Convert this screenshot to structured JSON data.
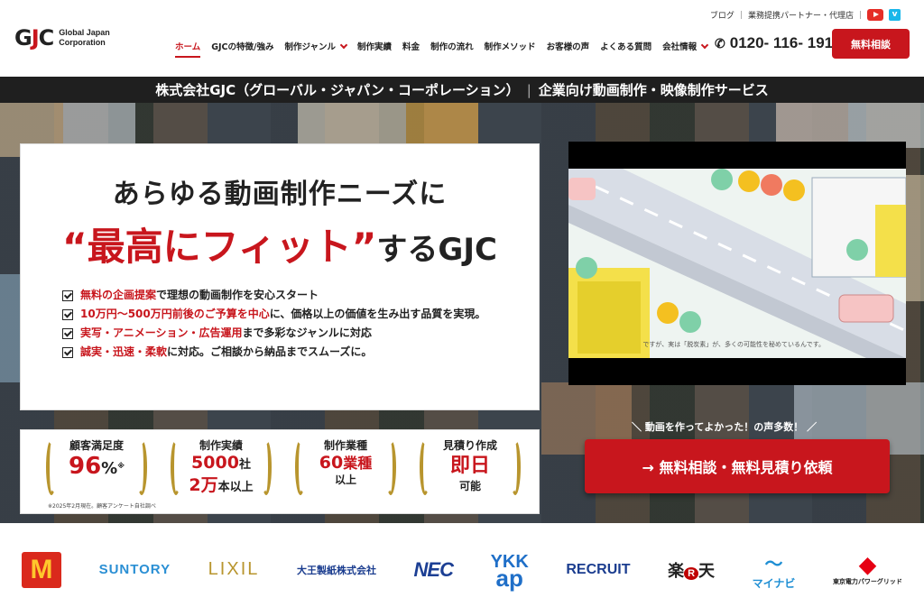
{
  "header": {
    "logo_mark_left": "G",
    "logo_mark_red": "J",
    "logo_mark_right": "C",
    "logo_text_line1": "Global Japan",
    "logo_text_line2": "Corporation",
    "toplinks": {
      "blog": "ブログ",
      "partner": "業務提携パートナー・代理店"
    },
    "nav": [
      {
        "label": "ホーム",
        "active": true
      },
      {
        "label": "GJCの特徴/強み"
      },
      {
        "label": "制作ジャンル"
      },
      {
        "label": "制作実績"
      },
      {
        "label": "料金"
      },
      {
        "label": "制作の流れ"
      },
      {
        "label": "制作メソッド"
      },
      {
        "label": "お客様の声"
      },
      {
        "label": "よくある質問"
      },
      {
        "label": "会社情報"
      }
    ],
    "phone": "0120- 116- 191",
    "cta": "無料相談"
  },
  "band": {
    "company": "株式会社GJC（グローバル・ジャパン・コーポレーション）",
    "service": "企業向け動画制作・映像制作サービス"
  },
  "hero": {
    "headline_line1": "あらゆる動画制作ニーズに",
    "headline_accent": "“最高にフィット”",
    "headline_rest": "するGJC",
    "checks": [
      {
        "red": "無料の企画提案",
        "text": "で理想の動画制作を安心スタート"
      },
      {
        "red": "10万円〜500万円前後のご予算を中心",
        "text": "に、価格以上の価値を生み出す品質を実現。"
      },
      {
        "red": "実写・アニメーション・広告運用",
        "text": "まで多彩なジャンルに対応"
      },
      {
        "red": "誠実・迅速・柔軟",
        "text": "に対応。ご相談から納品までスムーズに。"
      }
    ],
    "stats": [
      {
        "label": "顧客満足度",
        "big": "96",
        "unit": "%",
        "mark": "※"
      },
      {
        "label": "制作実績",
        "line1": "5000",
        "line1_unit": "社",
        "line2": "2万",
        "line2_unit": "本以上"
      },
      {
        "label": "制作業種",
        "line1": "60",
        "line1_unit": "業種",
        "line2_unit": "以上"
      },
      {
        "label": "見積り作成",
        "big": "即日",
        "sub": "可能"
      }
    ],
    "stat_note": "※2025年2月現在。顧客アンケート自社調べ",
    "video_caption": "ですが、実は「脱炭素」が、多くの可能性を秘めているんです。",
    "voice": "＼ 動画を作ってよかった！の声多数！ ／",
    "cta_main": "→ 無料相談・無料見積り依頼"
  },
  "logos": {
    "mcd": "M",
    "suntory": "SUNTORY",
    "lixil": "LIXIL",
    "daio": "大王製紙株式会社",
    "nec": "NEC",
    "ykk_top": "YKK",
    "ykk_bottom": "ap",
    "recruit": "RECRUIT",
    "rakuten_a": "楽",
    "rakuten_b": "R",
    "rakuten_c": "天",
    "mynavi": "マイナビ",
    "tepco": "東京電力パワーグリッド"
  },
  "colors": {
    "brand_red": "#c8161d",
    "gold": "#b8952e",
    "band": "#1f1f1f"
  }
}
